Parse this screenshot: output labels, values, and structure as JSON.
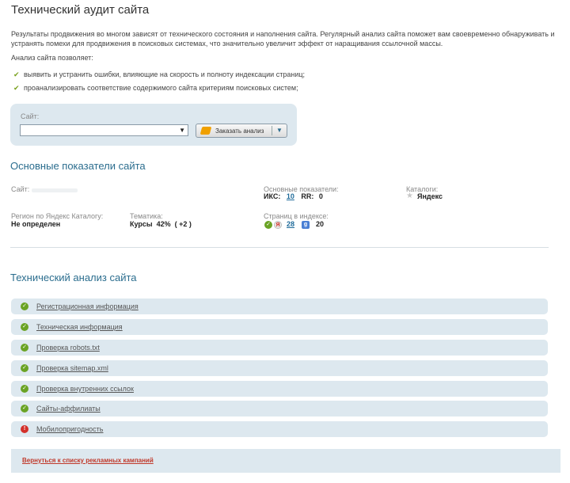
{
  "page_title": "Технический аудит сайта",
  "intro": "Результаты продвижения во многом зависят от технического состояния и наполнения сайта. Регулярный анализ сайта поможет вам своевременно обнаруживать и устранять помехи для продвижения в поисковых системах, что значительно увеличит эффект от наращивания ссылочной массы.",
  "allows_label": "Анализ сайта позволяет:",
  "bullets": [
    "выявить и устранить ошибки, влияющие на скорость и полноту индексации страниц;",
    "проанализировать соответствие содержимого сайта критериям поисковых систем;"
  ],
  "site_form": {
    "label": "Сайт:",
    "value": "",
    "order_button": "Заказать анализ"
  },
  "main_stats": {
    "title": "Основные показатели сайта",
    "site_label": "Сайт:",
    "indicators_label": "Основные показатели:",
    "iks_label": "ИКС:",
    "iks_value": "10",
    "rr_label": "RR:",
    "rr_value": "0",
    "catalogs_label": "Каталоги:",
    "catalogs_value": "Яндекс",
    "region_label": "Регион по Яндекс Каталогу:",
    "region_value": "Не определен",
    "topic_label": "Тематика:",
    "topic_value": "Курсы  42%  ( +2 )",
    "pages_label": "Страниц в индексе:",
    "pages_yandex": "28",
    "pages_google": "20"
  },
  "tech": {
    "title": "Технический анализ сайта",
    "items": [
      {
        "label": "Регистрационная информация",
        "status": "ok"
      },
      {
        "label": "Техническая информация",
        "status": "ok"
      },
      {
        "label": "Проверка robots.txt",
        "status": "ok"
      },
      {
        "label": "Проверка sitemap.xml",
        "status": "ok"
      },
      {
        "label": "Проверка внутренних ссылок",
        "status": "ok"
      },
      {
        "label": "Сайты-аффилиаты",
        "status": "ok"
      },
      {
        "label": "Мобилопригодность",
        "status": "error"
      }
    ]
  },
  "footer_link": "Вернуться к списку рекламных кампаний",
  "colors": {
    "accent": "#2b6d8e",
    "panel": "#dde8ef",
    "ok": "#6aa324",
    "error": "#d3302a",
    "footer_link": "#c0392b"
  }
}
